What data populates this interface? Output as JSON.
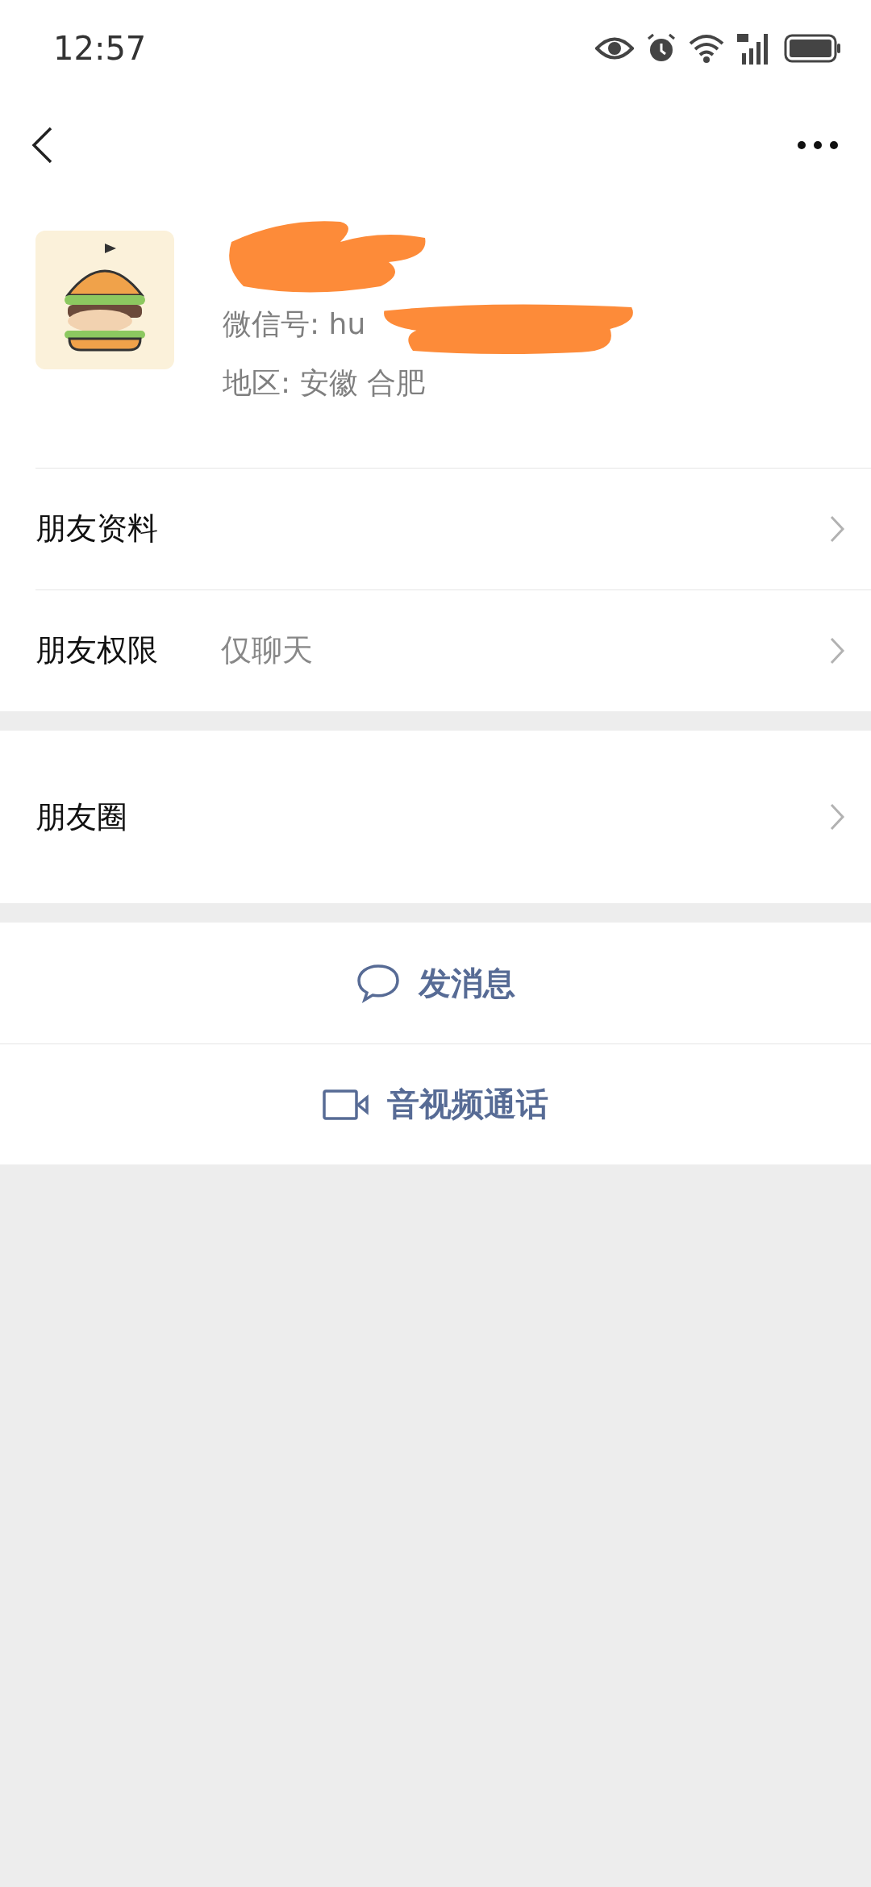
{
  "status_bar": {
    "time": "12:57"
  },
  "profile": {
    "wechat_id": "微信号: hu",
    "region": "地区: 安徽  合肥",
    "redacted": true
  },
  "rows": [
    {
      "label": "朋友资料"
    },
    {
      "label": "朋友权限",
      "value": "仅聊天"
    }
  ],
  "moments": {
    "label": "朋友圈"
  },
  "actions": [
    {
      "kind": "message",
      "label": "发消息"
    },
    {
      "kind": "video",
      "label": "音视频通话"
    }
  ]
}
